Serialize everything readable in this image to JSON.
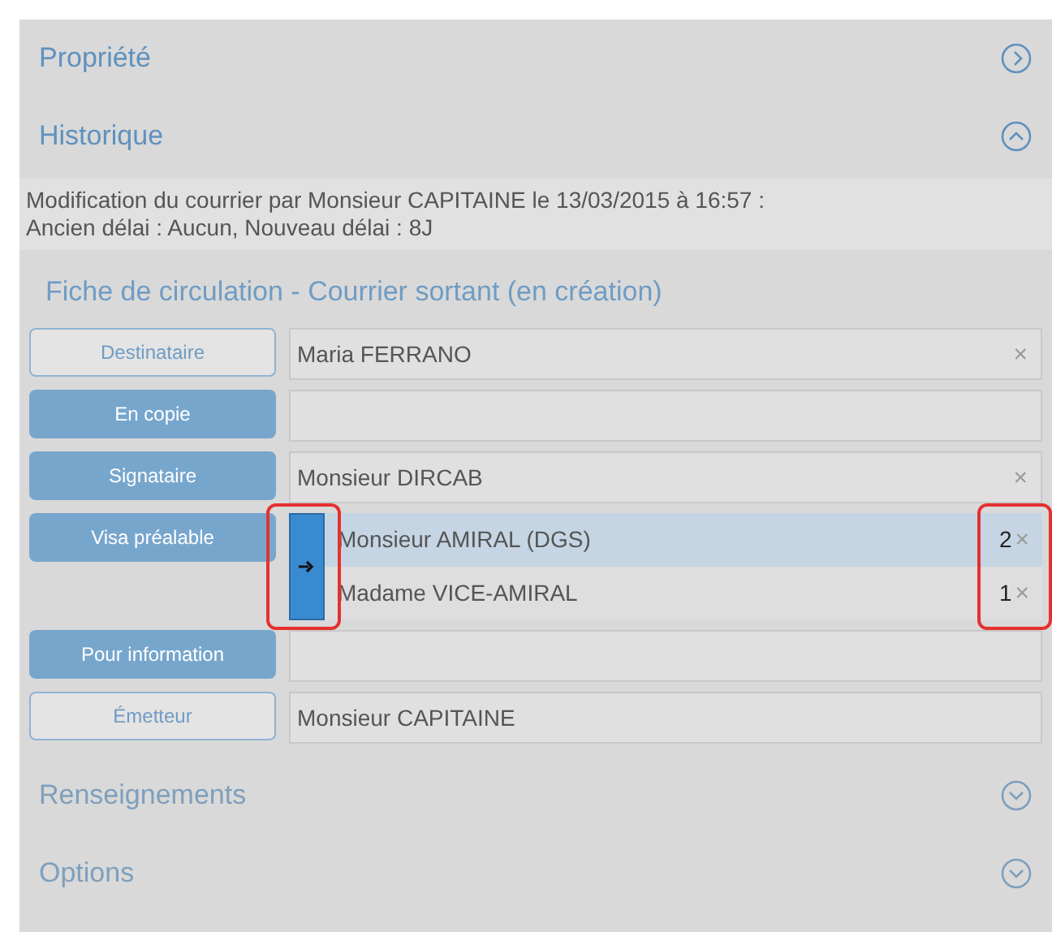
{
  "sections_top": [
    {
      "title": "Propriété",
      "kind": "right",
      "disabled": false
    },
    {
      "title": "Historique",
      "kind": "up",
      "disabled": false
    }
  ],
  "history_lines": [
    "Modification du courrier par Monsieur CAPITAINE le 13/03/2015 à 16:57 :",
    "Ancien délai : Aucun, Nouveau délai : 8J"
  ],
  "form": {
    "title": "Fiche de circulation - Courrier sortant (en création)",
    "rows": [
      {
        "label": "Destinataire",
        "kind": "outline",
        "values": [
          {
            "text": "Maria FERRANO",
            "remove": "×"
          }
        ]
      },
      {
        "label": "En copie",
        "kind": "filled",
        "values": []
      },
      {
        "label": "Signataire",
        "kind": "filled",
        "values": [
          {
            "text": "Monsieur DIRCAB",
            "remove": "×"
          }
        ]
      },
      {
        "label": "Visa préalable",
        "kind": "ordered",
        "values": [
          {
            "text": "Monsieur AMIRAL (DGS)",
            "rank": "2",
            "selected": true,
            "remove": "×"
          },
          {
            "text": "Madame VICE-AMIRAL",
            "rank": "1",
            "selected": false,
            "remove": "×"
          }
        ]
      },
      {
        "label": "Pour information",
        "kind": "filled",
        "values": []
      },
      {
        "label": "Émetteur",
        "kind": "outline",
        "values": [
          {
            "text": "Monsieur CAPITAINE"
          }
        ]
      }
    ]
  },
  "sections_bottom": [
    {
      "title": "Renseignements",
      "kind": "down",
      "disabled": true
    },
    {
      "title": "Options",
      "kind": "down",
      "disabled": true
    }
  ]
}
